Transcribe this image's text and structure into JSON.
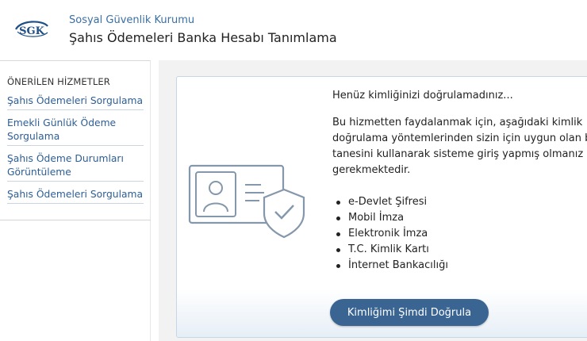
{
  "header": {
    "logo_text": "SGK",
    "organization": "Sosyal Güvenlik Kurumu",
    "service_title": "Şahıs Ödemeleri Banka Hesabı Tanımlama"
  },
  "sidebar": {
    "heading": "ÖNERİLEN HİZMETLER",
    "items": [
      {
        "label": "Şahıs Ödemeleri Sorgulama"
      },
      {
        "label": "Emekli Günlük Ödeme Sorgulama"
      },
      {
        "label": "Şahıs Ödeme Durumları Görüntüleme"
      },
      {
        "label": "Şahıs Ödemeleri Sorgulama"
      }
    ]
  },
  "main": {
    "notice_title": "Henüz kimliğinizi doğrulamadınız...",
    "notice_text": "Bu hizmetten faydalanmak için, aşağıdaki kimlik doğrulama yöntemlerinden sizin için uygun olan bir tanesini kullanarak sisteme giriş yapmış olmanız gerekmektedir.",
    "methods": [
      "e-Devlet Şifresi",
      "Mobil İmza",
      "Elektronik İmza",
      "T.C. Kimlik Kartı",
      "İnternet Bankacılığı"
    ],
    "verify_button": "Kimliğimi Şimdi Doğrula"
  },
  "colors": {
    "link": "#2d5e95",
    "button": "#3a6593",
    "illustration": "#8497ab",
    "org_text": "#3a6fa5"
  },
  "icons": {
    "logo": "sgk-logo",
    "illustration": "id-card-shield-check-icon"
  }
}
